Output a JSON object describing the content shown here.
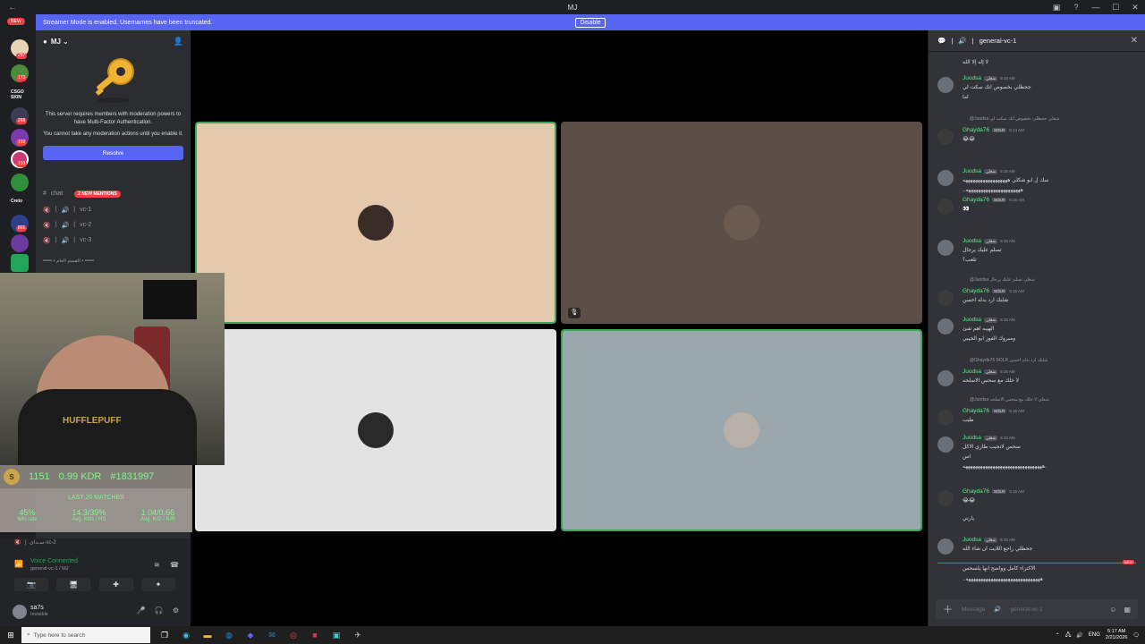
{
  "titlebar": {
    "title": "MJ"
  },
  "banner": {
    "message": "Streamer Mode is enabled. Usernames have been truncated.",
    "button": "Disable"
  },
  "rail": {
    "new_label": "NEW",
    "badges": [
      "32",
      "287",
      "173",
      "268",
      "102",
      "103",
      "801",
      "16",
      "6"
    ],
    "labels": [
      "CSGO SKIN",
      "Creto"
    ]
  },
  "sidebar": {
    "server_name": "MJ",
    "mfa_text_1": "This server requires members with moderation powers to have Multi-Factor Authentication.",
    "mfa_text_2": "You cannot take any moderation actions until you enable it.",
    "resolve_label": "Resolve",
    "channels": [
      {
        "name": "chat",
        "mentions": "2 NEW MENTIONS"
      },
      {
        "name": "vc-1"
      },
      {
        "name": "vc-2"
      },
      {
        "name": "vc-3"
      }
    ],
    "category": "━━━ • القسم العام • ━━━"
  },
  "webcam": {
    "shirt_text": "HUFFLEPUFF"
  },
  "stats": {
    "level": "S",
    "elo": "1151",
    "kdr": "0.99 KDR",
    "rank": "#1831997",
    "last": "LAST 20 MATCHES",
    "cols": [
      {
        "value": "45%",
        "label": "Win rate"
      },
      {
        "value": "14.3/39%",
        "label": "Avg. Kills / HS"
      },
      {
        "value": "1.04/0.66",
        "label": "Avg. K/D / K/R"
      }
    ]
  },
  "voice": {
    "other_channel": "سـداى-vc-2",
    "connected": "Voice Connected",
    "sub": "general-vc-1 / MJ",
    "user_name": "sa7s",
    "user_status": "Invisible"
  },
  "tiles": [
    {
      "bg": "#e4c9ac",
      "border": "#3ba55c",
      "avatar": "#3a2d28"
    },
    {
      "bg": "#5b4f47",
      "border": "#5b4f47",
      "avatar": "#6b5a50"
    },
    {
      "bg": "#e3e3e3",
      "border": "#e3e3e3",
      "avatar": "#2a2a2a"
    },
    {
      "bg": "#9aa7ad",
      "border": "#3ba55c",
      "avatar": "#b8b0a8"
    }
  ],
  "chat": {
    "channel": "general-vc-1",
    "top_text": "لا إله إلا الله",
    "messages": [
      {
        "user": "Juodsa",
        "tag": "شغلي",
        "time": "5:14 AM",
        "lines": [
          "جحظلي بخصوص انك سكت لي",
          "اما"
        ]
      },
      {
        "user": "Ghayda76",
        "tag": "SOLR",
        "time": "5:14 AM",
        "reply": "@Juodsa شغلي جحظلي بخصوص انك سكت لي",
        "emoji": "😂😂"
      },
      {
        "user": "Juodsa",
        "tag": "شغلي",
        "time": "5:15 AM",
        "lines": [
          "سك ل ابو شكلي ههههههههههههههههههه",
          "..ههههههههههههههههههههههه"
        ]
      },
      {
        "user": "Ghayda76",
        "tag": "SOLR",
        "time": "5:15 AM",
        "emoji": "👀"
      },
      {
        "user": "Juodsa",
        "tag": "شغلي",
        "time": "5:15 AM",
        "lines": [
          "تسلم عليك يرجال",
          "تلعب؟"
        ]
      },
      {
        "user": "Ghayda76",
        "tag": "SOLR",
        "time": "5:15 AM",
        "reply": "@Juodsa شغلي تسلم عليك يرجال",
        "lines": [
          "شلنك ارد بدله احسن"
        ]
      },
      {
        "user": "Juodsa",
        "tag": "شغلي",
        "time": "5:15 AM",
        "lines": [
          "الهيبه اهم شئ",
          "ومبروك الفوز ابو الجيبي"
        ]
      },
      {
        "user": "Juodsa",
        "tag": "شغلي",
        "time": "5:15 AM",
        "reply": "@Ghayda76 SOLR شلنك ارد بدله احسن",
        "lines": [
          "لا خلك مع سحس الاسلحه"
        ]
      },
      {
        "user": "Ghayda76",
        "tag": "SOLR",
        "time": "5:16 AM",
        "reply": "@Juodsa شغلي لا خلك مع سحس الاسلحه",
        "lines": [
          "طيب"
        ]
      },
      {
        "user": "Juodsa",
        "tag": "شغلي",
        "time": "5:16 AM",
        "lines": [
          "سحس لاتجيب طاري الاكل",
          "اس",
          "ههههههههههههههههههههههههههههههههه."
        ]
      },
      {
        "user": "Ghayda76",
        "tag": "SOLR",
        "time": "5:16 AM",
        "emoji": "😂😂",
        "lines": [
          "يارتي"
        ]
      },
      {
        "user": "Juodsa",
        "tag": "شغلي",
        "time": "5:16 AM",
        "lines": [
          "جحظلي راجع اللايت ان شاء الله"
        ]
      }
    ],
    "after_new": [
      "الاكتراء كامل وواضح انها يلسحس",
      "..ههههههههههههههههههههههههههههههه"
    ],
    "new_label": "NEW",
    "placeholder": "Message",
    "compose_channel": "general-vc-1"
  },
  "taskbar": {
    "search": "Type here to search",
    "lang": "ENG",
    "time": "5:17 AM",
    "date": "2/21/2026"
  },
  "colors": {
    "blurple": "#5865f2",
    "red": "#f23f43",
    "green": "#23a559",
    "stat_green": "#7ef58a"
  }
}
